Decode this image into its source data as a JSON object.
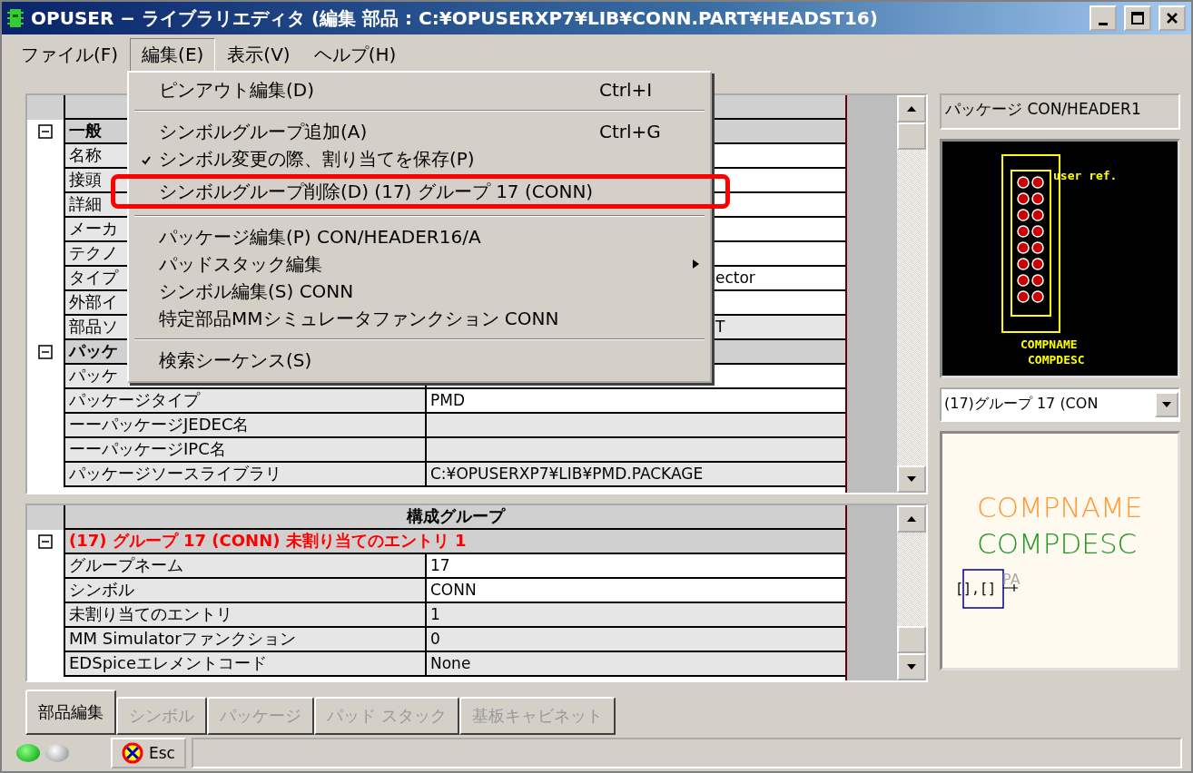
{
  "window": {
    "title": "OPUSER − ライブラリエディタ (編集 部品 : C:¥OPUSERXP7¥LIB¥CONN.PART¥HEADST16)"
  },
  "menubar": [
    {
      "label": "ファイル(F)",
      "selected": false
    },
    {
      "label": "編集(E)",
      "selected": true
    },
    {
      "label": "表示(V)",
      "selected": false
    },
    {
      "label": "ヘルプ(H)",
      "selected": false
    }
  ],
  "menu": [
    {
      "kind": "item",
      "label": "ピンアウト編集(D)",
      "shortcut": "Ctrl+I"
    },
    {
      "kind": "separator"
    },
    {
      "kind": "item",
      "label": "シンボルグループ追加(A)",
      "shortcut": "Ctrl+G"
    },
    {
      "kind": "item",
      "label": "シンボル変更の際、割り当てを保存(P)",
      "checked": true
    },
    {
      "kind": "item",
      "label": "シンボルグループ削除(D) (17) グループ 17 (CONN)",
      "highlighted": true
    },
    {
      "kind": "separator"
    },
    {
      "kind": "item",
      "label": "パッケージ編集(P) CON/HEADER16/A"
    },
    {
      "kind": "item",
      "label": "パッドスタック編集",
      "submenu": true
    },
    {
      "kind": "item",
      "label": "シンボル編集(S) CONN"
    },
    {
      "kind": "item",
      "label": "特定部品MMシミュレータファンクション CONN"
    },
    {
      "kind": "separator"
    },
    {
      "kind": "item",
      "label": "検索シーケンス(S)"
    }
  ],
  "upper_grid": {
    "rows": [
      {
        "kind": "header"
      },
      {
        "kind": "section",
        "label": "一般",
        "expanded": true
      },
      {
        "kind": "field",
        "label": "名称",
        "covered": true
      },
      {
        "kind": "field",
        "label": "接頭",
        "covered": true
      },
      {
        "kind": "field",
        "label": "詳細",
        "covered": true
      },
      {
        "kind": "field",
        "label": "メーカ",
        "covered": true
      },
      {
        "kind": "field",
        "label": "テクノ",
        "covered": true
      },
      {
        "kind": "field",
        "label": "タイプ",
        "value": "ector",
        "covered": true
      },
      {
        "kind": "field",
        "label": "外部イ",
        "covered": true
      },
      {
        "kind": "field",
        "label": "部品ソ",
        "value": "T",
        "readonly": true,
        "covered": true
      },
      {
        "kind": "section",
        "label": "パッケ",
        "expanded": true
      },
      {
        "kind": "field",
        "label": "パッケ",
        "covered": true
      },
      {
        "kind": "field",
        "label": "パッケージタイプ",
        "value": "PMD"
      },
      {
        "kind": "field",
        "label": "ーーパッケージJEDEC名",
        "readonly": true
      },
      {
        "kind": "field",
        "label": "ーーパッケージIPC名",
        "readonly": true
      },
      {
        "kind": "field",
        "label": "パッケージソースライブラリ",
        "value": "C:¥OPUSERXP7¥LIB¥PMD.PACKAGE",
        "readonly": true
      }
    ]
  },
  "lower_grid": {
    "rows": [
      {
        "kind": "header",
        "label": "構成グループ"
      },
      {
        "kind": "section",
        "label": "(17) グループ 17 (CONN) 未割り当てのエントリ 1",
        "expanded": true,
        "warning": true
      },
      {
        "kind": "field",
        "label": "グループネーム",
        "value": "17"
      },
      {
        "kind": "field",
        "label": "シンボル",
        "value": "CONN"
      },
      {
        "kind": "field",
        "label": "未割り当てのエントリ",
        "value": "1",
        "readonly": true
      },
      {
        "kind": "field",
        "label": "MM Simulatorファンクション",
        "value": " 0",
        "readonly": true
      },
      {
        "kind": "field",
        "label": "EDSpiceエレメントコード",
        "value": "None",
        "readonly": true
      }
    ]
  },
  "tabs": [
    {
      "label": "部品編集",
      "selected": true
    },
    {
      "label": "シンボル",
      "selected": false
    },
    {
      "label": "パッケージ",
      "selected": false
    },
    {
      "label": "パッド スタック",
      "selected": false
    },
    {
      "label": "基板キャビネット",
      "selected": false
    }
  ],
  "package_preview": {
    "field": "パッケージ CON/HEADER1",
    "ref_text": "user ref.",
    "name_text": "COMPNAME",
    "desc_text": "COMPDESC"
  },
  "group_select": {
    "value": "(17)グループ 17 (CON"
  },
  "symbol_preview": {
    "name_text": "COMPNAME",
    "desc_text": "COMPDESC",
    "pins_text": "[],[]",
    "pin_label": "PA"
  },
  "status_bar": {
    "leds": [
      {
        "on": true
      },
      {
        "on": false
      }
    ],
    "esc_button": "Esc"
  }
}
